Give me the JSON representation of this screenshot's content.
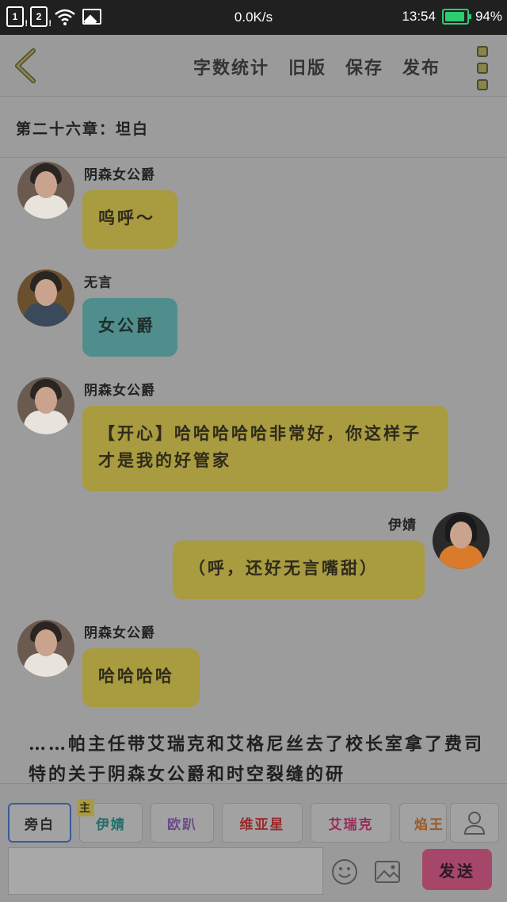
{
  "status_bar": {
    "sim1": "1",
    "sim2": "2",
    "net_speed": "0.0K/s",
    "time": "13:54",
    "battery": "94%",
    "battery_level": 0.94
  },
  "header": {
    "actions": [
      "字数统计",
      "旧版",
      "保存",
      "发布"
    ]
  },
  "chapter_title": "第二十六章：坦白",
  "messages": [
    {
      "name": "阴森女公爵",
      "text": "呜呼～",
      "side": "left",
      "color": "#a99b3f"
    },
    {
      "name": "无言",
      "text": "女公爵",
      "side": "left",
      "color": "#4f8e8c"
    },
    {
      "name": "阴森女公爵",
      "text": "【开心】哈哈哈哈哈非常好，你这样子才是我的好管家",
      "side": "left",
      "color": "#a99b3f"
    },
    {
      "name": "伊婧",
      "text": "（呼，还好无言嘴甜）",
      "side": "right",
      "color": "#a99b3f"
    },
    {
      "name": "阴森女公爵",
      "text": "哈哈哈哈",
      "side": "left",
      "color": "#a99b3f"
    }
  ],
  "narration": "……帕主任带艾瑞克和艾格尼丝去了校长室拿了费司特的关于阴森女公爵和时空裂缝的研",
  "roles": [
    {
      "label": "旁白",
      "color": "#2a2a2a",
      "active": true
    },
    {
      "label": "伊婧",
      "color": "#1e6e6a",
      "tag": "主"
    },
    {
      "label": "欧趴",
      "color": "#6a4a8a"
    },
    {
      "label": "维亚星",
      "color": "#9a2a2a"
    },
    {
      "label": "艾瑞克",
      "color": "#9a2a5a"
    },
    {
      "label": "焰王",
      "color": "#9a5a2a"
    }
  ],
  "send_label": "发送"
}
